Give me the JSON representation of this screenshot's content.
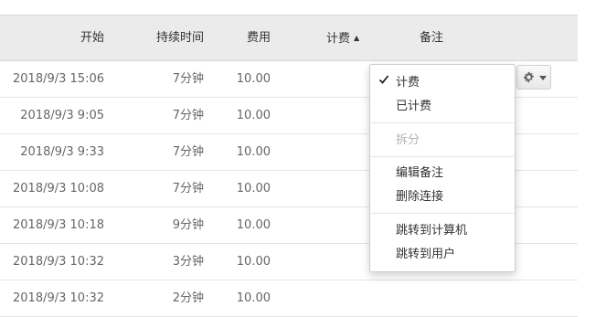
{
  "table": {
    "columns": {
      "start": "开始",
      "duration": "持续时间",
      "fee": "费用",
      "billing": "计费",
      "note": "备注"
    },
    "sort": {
      "column": "billing",
      "direction": "ascending",
      "indicator": "▲"
    },
    "rows": [
      {
        "start": "2018/9/3 15:06",
        "duration": "7分钟",
        "fee": "10.00"
      },
      {
        "start": "2018/9/3 9:05",
        "duration": "7分钟",
        "fee": "10.00"
      },
      {
        "start": "2018/9/3 9:33",
        "duration": "7分钟",
        "fee": "10.00"
      },
      {
        "start": "2018/9/3 10:08",
        "duration": "7分钟",
        "fee": "10.00"
      },
      {
        "start": "2018/9/3 10:18",
        "duration": "9分钟",
        "fee": "10.00"
      },
      {
        "start": "2018/9/3 10:32",
        "duration": "3分钟",
        "fee": "10.00"
      },
      {
        "start": "2018/9/3 10:32",
        "duration": "2分钟",
        "fee": "10.00"
      }
    ]
  },
  "row_actions": {
    "button_icon": "gear-icon",
    "dropdown_icon": "caret-down-icon"
  },
  "context_menu": {
    "items": [
      {
        "label": "计费",
        "checked": true,
        "enabled": true
      },
      {
        "label": "已计费",
        "checked": false,
        "enabled": true
      },
      {
        "label": "拆分",
        "checked": false,
        "enabled": false
      },
      {
        "label": "编辑备注",
        "checked": false,
        "enabled": true
      },
      {
        "label": "删除连接",
        "checked": false,
        "enabled": true
      },
      {
        "label": "跳转到计算机",
        "checked": false,
        "enabled": true
      },
      {
        "label": "跳转到用户",
        "checked": false,
        "enabled": true
      }
    ]
  },
  "colors": {
    "header_background": "#ebebeb",
    "row_border": "#e4e4e4",
    "text": "#666666",
    "disabled_text": "#b3b3b3"
  }
}
